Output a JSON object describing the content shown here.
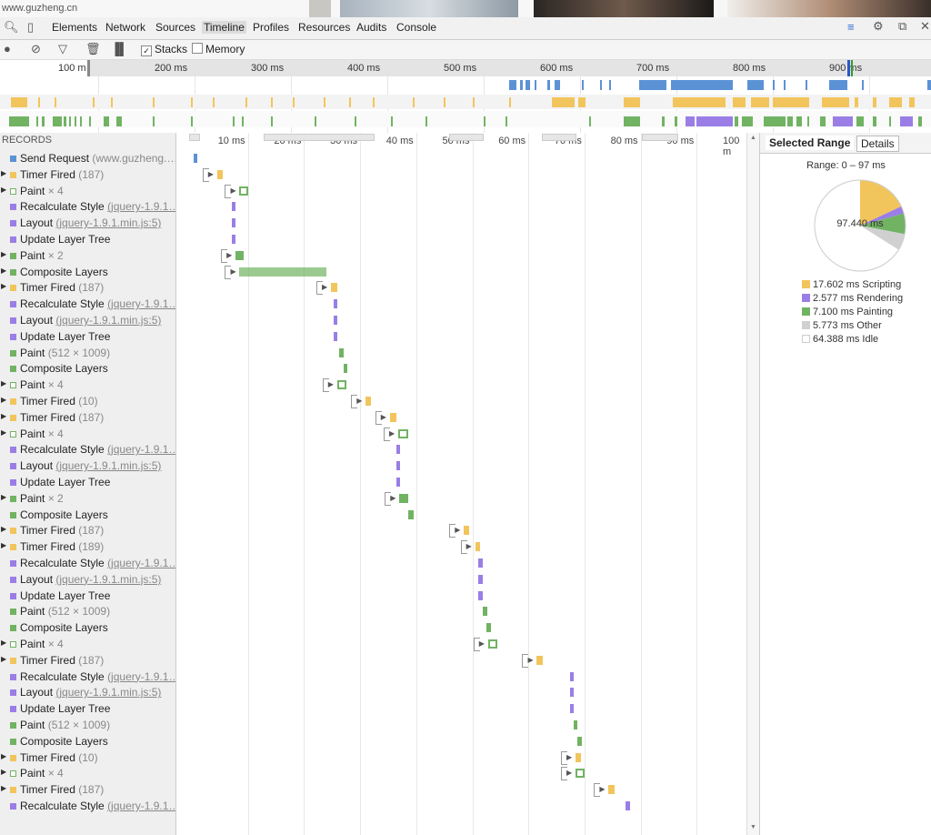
{
  "page": {
    "site": "www.guzheng.cn"
  },
  "devtools": {
    "tabs": [
      "Elements",
      "Network",
      "Sources",
      "Timeline",
      "Profiles",
      "Resources",
      "Audits",
      "Console"
    ],
    "active_tab": "Timeline"
  },
  "toolbar": {
    "stacks_label": "Stacks",
    "memory_label": "Memory",
    "stacks_checked": true,
    "memory_checked": false
  },
  "overview": {
    "ruler_labels": [
      "100 m",
      "200 ms",
      "300 ms",
      "400 ms",
      "500 ms",
      "600 ms",
      "700 ms",
      "800 ms",
      "900 ms"
    ]
  },
  "records": {
    "header": "RECORDS",
    "items": [
      {
        "label": "Send Request",
        "detail": "(www.guzheng.…",
        "cat": "loading",
        "expand": false,
        "hollow": false
      },
      {
        "label": "Timer Fired",
        "detail": "(187)",
        "cat": "scripting",
        "expand": true,
        "hollow": false
      },
      {
        "label": "Paint",
        "detail": "× 4",
        "cat": "painting",
        "expand": true,
        "hollow": true
      },
      {
        "label": "Recalculate Style",
        "link": "(jquery-1.9.1…",
        "cat": "rendering",
        "expand": false,
        "hollow": false
      },
      {
        "label": "Layout",
        "link": "(jquery-1.9.1.min.js:5)",
        "cat": "rendering",
        "expand": false,
        "hollow": false
      },
      {
        "label": "Update Layer Tree",
        "cat": "rendering",
        "expand": false,
        "hollow": false
      },
      {
        "label": "Paint",
        "detail": "× 2",
        "cat": "painting",
        "expand": true,
        "hollow": false
      },
      {
        "label": "Composite Layers",
        "cat": "painting",
        "expand": true,
        "hollow": false
      },
      {
        "label": "Timer Fired",
        "detail": "(187)",
        "cat": "scripting",
        "expand": true,
        "hollow": false
      },
      {
        "label": "Recalculate Style",
        "link": "(jquery-1.9.1…",
        "cat": "rendering",
        "expand": false,
        "hollow": false
      },
      {
        "label": "Layout",
        "link": "(jquery-1.9.1.min.js:5)",
        "cat": "rendering",
        "expand": false,
        "hollow": false
      },
      {
        "label": "Update Layer Tree",
        "cat": "rendering",
        "expand": false,
        "hollow": false
      },
      {
        "label": "Paint",
        "detail": "(512 × 1009)",
        "cat": "painting",
        "expand": false,
        "hollow": false
      },
      {
        "label": "Composite Layers",
        "cat": "painting",
        "expand": false,
        "hollow": false
      },
      {
        "label": "Paint",
        "detail": "× 4",
        "cat": "painting",
        "expand": true,
        "hollow": true
      },
      {
        "label": "Timer Fired",
        "detail": "(10)",
        "cat": "scripting",
        "expand": true,
        "hollow": false
      },
      {
        "label": "Timer Fired",
        "detail": "(187)",
        "cat": "scripting",
        "expand": true,
        "hollow": false
      },
      {
        "label": "Paint",
        "detail": "× 4",
        "cat": "painting",
        "expand": true,
        "hollow": true
      },
      {
        "label": "Recalculate Style",
        "link": "(jquery-1.9.1…",
        "cat": "rendering",
        "expand": false,
        "hollow": false
      },
      {
        "label": "Layout",
        "link": "(jquery-1.9.1.min.js:5)",
        "cat": "rendering",
        "expand": false,
        "hollow": false
      },
      {
        "label": "Update Layer Tree",
        "cat": "rendering",
        "expand": false,
        "hollow": false
      },
      {
        "label": "Paint",
        "detail": "× 2",
        "cat": "painting",
        "expand": true,
        "hollow": false
      },
      {
        "label": "Composite Layers",
        "cat": "painting",
        "expand": false,
        "hollow": false
      },
      {
        "label": "Timer Fired",
        "detail": "(187)",
        "cat": "scripting",
        "expand": true,
        "hollow": false
      },
      {
        "label": "Timer Fired",
        "detail": "(189)",
        "cat": "scripting",
        "expand": true,
        "hollow": false
      },
      {
        "label": "Recalculate Style",
        "link": "(jquery-1.9.1…",
        "cat": "rendering",
        "expand": false,
        "hollow": false
      },
      {
        "label": "Layout",
        "link": "(jquery-1.9.1.min.js:5)",
        "cat": "rendering",
        "expand": false,
        "hollow": false
      },
      {
        "label": "Update Layer Tree",
        "cat": "rendering",
        "expand": false,
        "hollow": false
      },
      {
        "label": "Paint",
        "detail": "(512 × 1009)",
        "cat": "painting",
        "expand": false,
        "hollow": false
      },
      {
        "label": "Composite Layers",
        "cat": "painting",
        "expand": false,
        "hollow": false
      },
      {
        "label": "Paint",
        "detail": "× 4",
        "cat": "painting",
        "expand": true,
        "hollow": true
      },
      {
        "label": "Timer Fired",
        "detail": "(187)",
        "cat": "scripting",
        "expand": true,
        "hollow": false
      },
      {
        "label": "Recalculate Style",
        "link": "(jquery-1.9.1…",
        "cat": "rendering",
        "expand": false,
        "hollow": false
      },
      {
        "label": "Layout",
        "link": "(jquery-1.9.1.min.js:5)",
        "cat": "rendering",
        "expand": false,
        "hollow": false
      },
      {
        "label": "Update Layer Tree",
        "cat": "rendering",
        "expand": false,
        "hollow": false
      },
      {
        "label": "Paint",
        "detail": "(512 × 1009)",
        "cat": "painting",
        "expand": false,
        "hollow": false
      },
      {
        "label": "Composite Layers",
        "cat": "painting",
        "expand": false,
        "hollow": false
      },
      {
        "label": "Timer Fired",
        "detail": "(10)",
        "cat": "scripting",
        "expand": true,
        "hollow": false
      },
      {
        "label": "Paint",
        "detail": "× 4",
        "cat": "painting",
        "expand": true,
        "hollow": true
      },
      {
        "label": "Timer Fired",
        "detail": "(187)",
        "cat": "scripting",
        "expand": true,
        "hollow": false
      },
      {
        "label": "Recalculate Style",
        "link": "(jquery-1.9.1…",
        "cat": "rendering",
        "expand": false,
        "hollow": false
      }
    ]
  },
  "timeline": {
    "labels": [
      "10 ms",
      "20 ms",
      "30 ms",
      "40 ms",
      "50 ms",
      "60 ms",
      "70 ms",
      "80 ms",
      "90 ms",
      "100 m"
    ],
    "bars_ms": [
      [
        0.3,
        0.8
      ],
      [
        4.5,
        5.5
      ],
      [
        8.5,
        10.0
      ],
      [
        7.2,
        7.7
      ],
      [
        7.2,
        7.7
      ],
      [
        7.2,
        7.7
      ],
      [
        7.8,
        9.2
      ],
      [
        8.5,
        24.0
      ],
      [
        24.8,
        26.0
      ],
      [
        25.3,
        25.8
      ],
      [
        25.3,
        25.8
      ],
      [
        25.3,
        25.8
      ],
      [
        26.2,
        27.0
      ],
      [
        27.0,
        27.7
      ],
      [
        25.9,
        27.5
      ],
      [
        31.0,
        32.0
      ],
      [
        35.3,
        36.5
      ],
      [
        36.8,
        38.5
      ],
      [
        36.5,
        37.0
      ],
      [
        36.5,
        37.0
      ],
      [
        36.5,
        37.0
      ],
      [
        37.0,
        38.5
      ],
      [
        38.5,
        39.5
      ],
      [
        48.5,
        49.5
      ],
      [
        50.5,
        51.4
      ],
      [
        51.1,
        51.8
      ],
      [
        51.1,
        51.8
      ],
      [
        51.1,
        51.8
      ],
      [
        51.8,
        52.6
      ],
      [
        52.5,
        53.3
      ],
      [
        52.8,
        54.4
      ],
      [
        61.5,
        62.6
      ],
      [
        67.4,
        68.1
      ],
      [
        67.4,
        68.1
      ],
      [
        67.4,
        68.1
      ],
      [
        68.0,
        68.8
      ],
      [
        68.8,
        69.5
      ],
      [
        68.4,
        69.4
      ],
      [
        68.4,
        70.0
      ],
      [
        74.3,
        75.3
      ],
      [
        77.3,
        78.1
      ]
    ],
    "expanders": [
      1,
      2,
      6,
      7,
      8,
      14,
      15,
      16,
      17,
      21,
      23,
      24,
      30,
      31,
      37,
      38,
      39
    ]
  },
  "summary": {
    "tabs": [
      "Selected Range",
      "Details"
    ],
    "range": "Range: 0 – 97 ms",
    "total": "97.440 ms",
    "legend": [
      {
        "label": "17.602 ms Scripting",
        "value": 17.602,
        "color": "#f2c55c"
      },
      {
        "label": "2.577 ms Rendering",
        "value": 2.577,
        "color": "#9a7ee6"
      },
      {
        "label": "7.100 ms Painting",
        "value": 7.1,
        "color": "#71b363"
      },
      {
        "label": "5.773 ms Other",
        "value": 5.773,
        "color": "#d0d0d0"
      },
      {
        "label": "64.388 ms Idle",
        "value": 64.388,
        "color": "#ffffff"
      }
    ]
  },
  "colors": {
    "loading": "#5b92d6",
    "scripting": "#f2c55c",
    "rendering": "#9a7ee6",
    "painting": "#71b363"
  }
}
